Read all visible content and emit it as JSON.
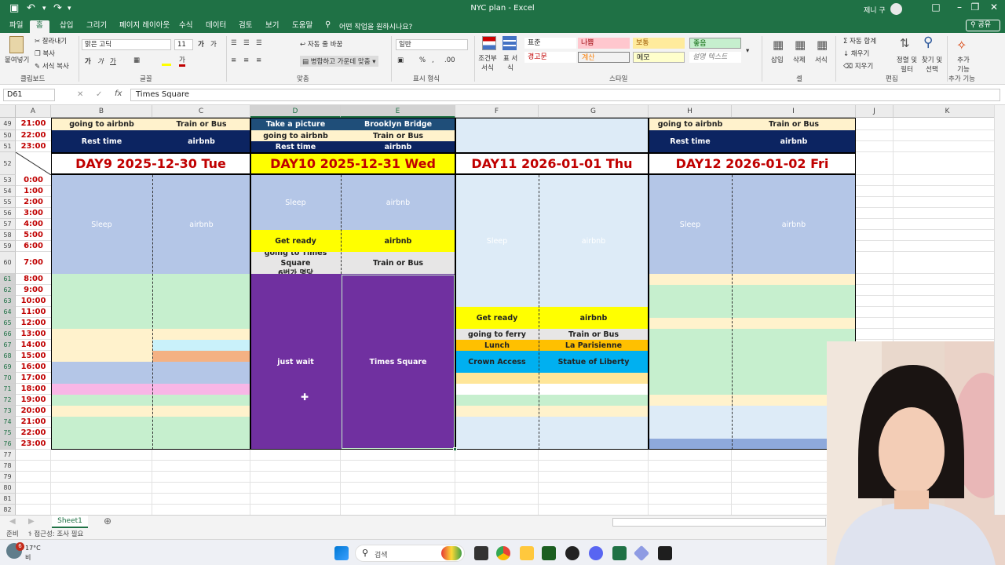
{
  "window": {
    "title": "NYC plan  -  Excel",
    "user": "제니 구"
  },
  "menu_tabs": [
    "파일",
    "홈",
    "삽입",
    "그리기",
    "페이지 레이아웃",
    "수식",
    "데이터",
    "검토",
    "보기",
    "도움말"
  ],
  "tell_me": "어떤 작업을 원하시나요?",
  "share_label": "공유",
  "ribbon": {
    "clipboard": {
      "paste": "붙여넣기",
      "cut": "잘라내기",
      "copy": "복사",
      "format_painter": "서식 복사",
      "group": "클립보드"
    },
    "font": {
      "name": "맑은 고딕",
      "size": "11",
      "group": "글꼴"
    },
    "alignment": {
      "wrap": "자동 줄 바꿈",
      "merge": "병합하고 가운데 맞춤",
      "group": "맞춤"
    },
    "number": {
      "format": "일반",
      "group": "표시 형식"
    },
    "styles": {
      "conditional": "조건부 서식",
      "table": "표 서식",
      "normal": "표준",
      "bad": "나쁨",
      "neutral": "보통",
      "good": "좋음",
      "check": "경고문",
      "calc": "계산",
      "memo": "메모",
      "explain": "설명 텍스트",
      "group": "스타일"
    },
    "cells": {
      "insert": "삽입",
      "delete": "삭제",
      "format": "서식",
      "group": "셀"
    },
    "editing": {
      "autosum": "자동 합계",
      "fill": "채우기",
      "clear": "지우기",
      "sort": "정렬 및 필터",
      "find": "찾기 및 선택",
      "group": "편집"
    },
    "addins": {
      "label": "추가 기능",
      "group": "추가 기능"
    }
  },
  "formula_bar": {
    "namebox": "D61",
    "content": "Times Square"
  },
  "columns": [
    "A",
    "B",
    "C",
    "D",
    "E",
    "F",
    "G",
    "H",
    "I",
    "J",
    "K"
  ],
  "rows": [
    "49",
    "50",
    "51",
    "52",
    "53",
    "54",
    "55",
    "56",
    "57",
    "58",
    "59",
    "60",
    "61",
    "62",
    "63",
    "64",
    "65",
    "66",
    "67",
    "68",
    "69",
    "70",
    "71",
    "72",
    "73",
    "74",
    "75",
    "76",
    "77",
    "78",
    "79",
    "80",
    "81",
    "82"
  ],
  "times": {
    "r49": "21:00",
    "r50": "22:00",
    "r51": "23:00",
    "r53": "0:00",
    "r54": "1:00",
    "r55": "2:00",
    "r56": "3:00",
    "r57": "4:00",
    "r58": "5:00",
    "r59": "6:00",
    "r60": "7:00",
    "r61": "8:00",
    "r62": "9:00",
    "r63": "10:00",
    "r64": "11:00",
    "r65": "12:00",
    "r66": "13:00",
    "r67": "14:00",
    "r68": "15:00",
    "r69": "16:00",
    "r70": "17:00",
    "r71": "18:00",
    "r72": "19:00",
    "r73": "20:00",
    "r74": "21:00",
    "r75": "22:00",
    "r76": "23:00"
  },
  "cells": {
    "B49": "going to airbnb",
    "C49": "Train or Bus",
    "D49": "Take a picture",
    "E49": "Brooklyn Bridge",
    "H49": "going to airbnb",
    "I49": "Train or Bus",
    "B50": "Rest time",
    "C50": "airbnb",
    "D50": "going to airbnb",
    "E50": "Train or Bus",
    "H50": "Rest time",
    "I50": "airbnb",
    "D51": "Rest time",
    "E51": "airbnb",
    "day9": "DAY9  2025-12-30 Tue",
    "day10": "DAY10  2025-12-31 Wed",
    "day11": "DAY11  2026-01-01 Thu",
    "day12": "DAY12  2026-01-02 Fri",
    "B_sleep": "Sleep",
    "C_sleep": "airbnb",
    "D_sleep": "Sleep",
    "E_sleep": "airbnb",
    "F_sleep": "Sleep",
    "G_sleep": "airbnb",
    "H_sleep": "Sleep",
    "I_sleep": "airbnb",
    "D58": "Get ready",
    "E58": "airbnb",
    "D60": "going to Times Square\n6번가 명당",
    "E60": "Train or Bus",
    "D_wait": "just wait",
    "E_ts": "Times Square",
    "F64": "Get ready",
    "G64": "airbnb",
    "F66": "going to ferry",
    "G66": "Train or Bus",
    "F67": "Lunch",
    "G67": "La Parisienne",
    "F68": "Crown Access",
    "G68": "Statue of Liberty"
  },
  "sheet_tab": "Sheet1",
  "status": {
    "ready": "준비",
    "accessibility": "접근성: 조사 필요"
  },
  "taskbar": {
    "weather": "17°C",
    "weather_sub": "비",
    "badge": "6",
    "search": "검색"
  },
  "colors": {
    "excel_green": "#1f7145",
    "navy": "#0c2461",
    "yellow": "#ffff00",
    "purple": "#7030a0",
    "sleep_blue": "#b4c6e7",
    "light_green": "#c6efce",
    "cream": "#fff2cc",
    "orange": "#ffc000",
    "cyan": "#00b0f0"
  }
}
